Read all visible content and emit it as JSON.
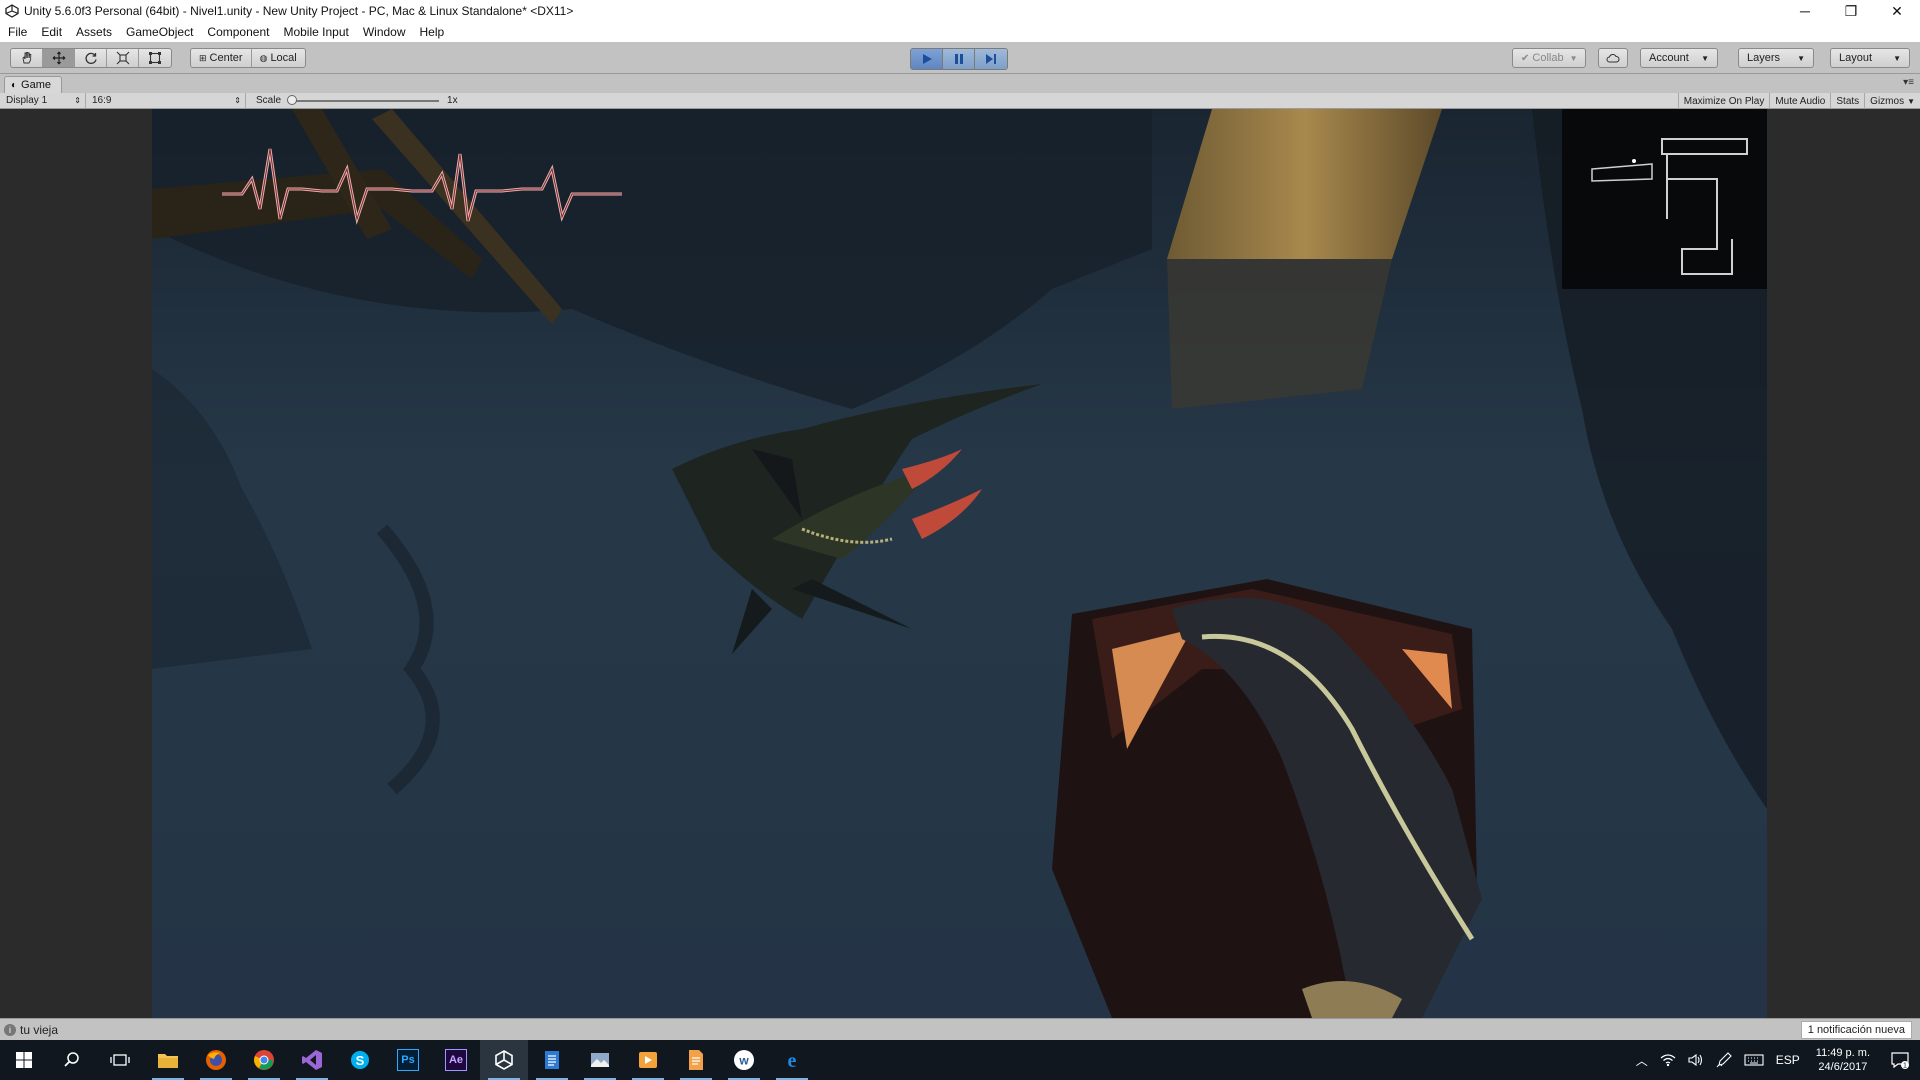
{
  "window": {
    "title": "Unity 5.6.0f3 Personal (64bit) - Nivel1.unity - New Unity Project - PC, Mac & Linux Standalone* <DX11>",
    "minimize_glyph": "─",
    "restore_glyph": "❐",
    "close_glyph": "✕"
  },
  "menu": [
    "File",
    "Edit",
    "Assets",
    "GameObject",
    "Component",
    "Mobile Input",
    "Window",
    "Help"
  ],
  "toolbar": {
    "transform_tools": [
      "hand-icon",
      "move-icon",
      "rotate-icon",
      "scale-icon",
      "rect-icon"
    ],
    "pivot": "Center",
    "space": "Local",
    "collab": "Collab",
    "account": "Account",
    "layers": "Layers",
    "layout": "Layout"
  },
  "game_tab": {
    "label": "Game",
    "display": "Display 1",
    "aspect": "16:9",
    "scale_label": "Scale",
    "scale_value": "1x",
    "scale_fraction": 0.0,
    "options": [
      "Maximize On Play",
      "Mute Audio",
      "Stats",
      "Gizmos"
    ]
  },
  "status": {
    "message": "tu vieja",
    "notification": "1 notificación nueva"
  },
  "taskbar": {
    "apps": [
      "file-explorer-icon",
      "firefox-icon",
      "chrome-icon",
      "visual-studio-icon",
      "skype-icon",
      "photoshop-icon",
      "after-effects-icon",
      "unity-icon",
      "notepad-icon",
      "photos-icon",
      "media-player-icon",
      "document-icon",
      "wattpad-icon",
      "edge-icon"
    ],
    "ps_label": "Ps",
    "ae_label": "Ae",
    "lang": "ESP",
    "time": "11:49 p. m.",
    "date": "24/6/2017",
    "notif_count": "1"
  },
  "colors": {
    "play_active": "#5f86c0",
    "heartbeat": "#e8b0b0",
    "water": "#1f2b38"
  }
}
